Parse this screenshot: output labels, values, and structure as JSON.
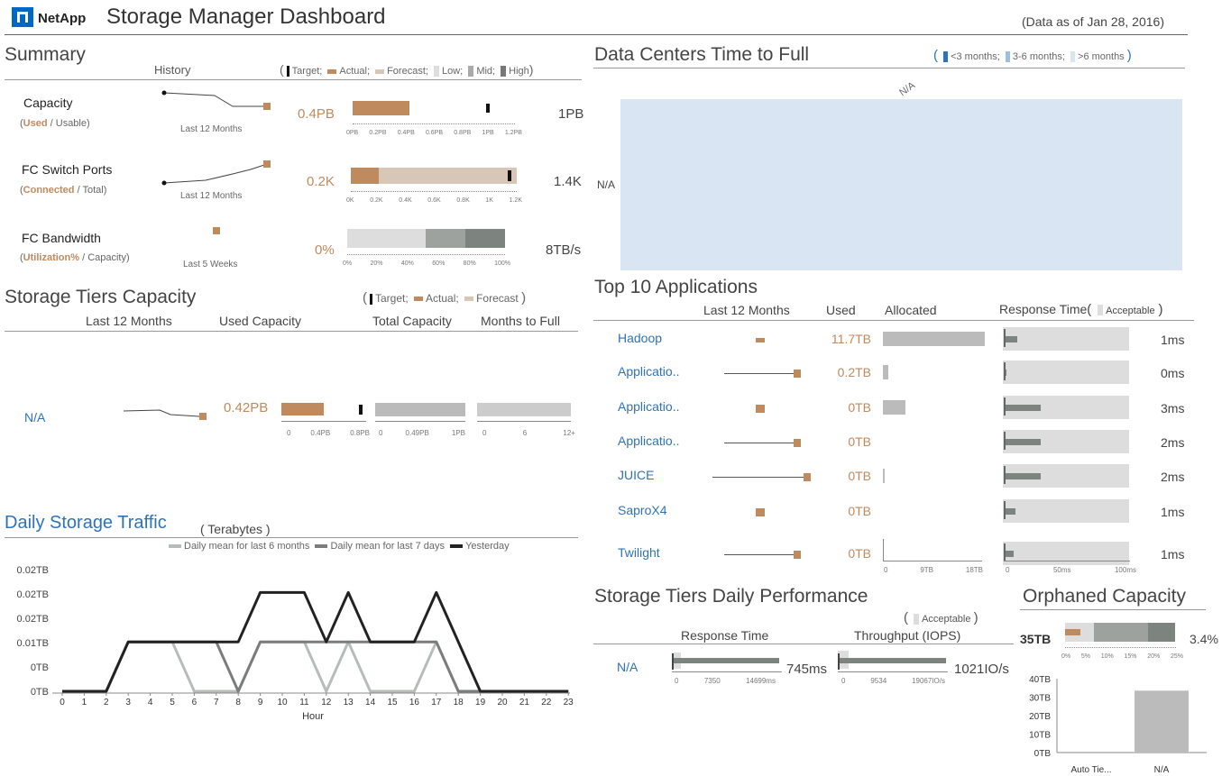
{
  "header": {
    "brand": "NetApp",
    "title": "Storage Manager Dashboard",
    "data_as_of": "(Data as of Jan 28, 2016)"
  },
  "summary": {
    "title": "Summary",
    "history_label": "History",
    "legend": {
      "target": "Target;",
      "actual": "Actual;",
      "forecast": "Forecast;",
      "low": "Low;",
      "mid": "Mid;",
      "high": "High"
    },
    "rows": [
      {
        "name": "Capacity",
        "sub_a": "Used",
        "sub_sep": " / ",
        "sub_b": "Usable",
        "period": "Last 12 Months",
        "actual": "0.4PB",
        "total": "1PB",
        "ticks": [
          "0PB",
          "0.2PB",
          "0.4PB",
          "0.6PB",
          "0.8PB",
          "1PB",
          "1.2PB"
        ],
        "actual_frac": 0.33,
        "target_frac": 0.83
      },
      {
        "name": "FC Switch Ports",
        "sub_a": "Connected",
        "sub_sep": " / ",
        "sub_b": "Total",
        "period": "Last 12 Months",
        "actual": "0.2K",
        "total": "1.4K",
        "ticks": [
          "0K",
          "0.2K",
          "0.4K",
          "0.6K",
          "0.8K",
          "1K",
          "1.2K"
        ],
        "actual_frac": 0.17,
        "forecast_frac": 1.0,
        "target_frac": 0.97
      },
      {
        "name": "FC Bandwidth",
        "sub_a": "Utilization%",
        "sub_sep": " / ",
        "sub_b": "Capacity)",
        "period": "Last 5 Weeks",
        "actual": "0%",
        "total": "8TB/s",
        "ticks": [
          "0%",
          "20%",
          "40%",
          "60%",
          "80%",
          "100%"
        ],
        "low_frac": 0.5,
        "mid_frac": 0.75
      }
    ]
  },
  "tiers": {
    "title": "Storage Tiers Capacity",
    "legend": {
      "target": "Target;",
      "actual": "Actual;",
      "forecast": "Forecast"
    },
    "columns": [
      "Last 12 Months",
      "Used Capacity",
      "Total Capacity",
      "Months to Full"
    ],
    "row": {
      "name": "N/A",
      "used": "0.42PB",
      "used_ticks": [
        "0",
        "0.4PB",
        "0.8PB"
      ],
      "total_ticks": [
        "0",
        "0.49PB",
        "1PB"
      ],
      "months_ticks": [
        "0",
        "6",
        "12+"
      ]
    }
  },
  "traffic": {
    "title": "Daily Storage Traffic",
    "unit": "( Terabytes )",
    "legend": [
      "Daily mean for last 6 months",
      "Daily mean for last 7 days",
      "Yesterday"
    ],
    "colors": [
      "#b8bcb9",
      "#7a7d7b",
      "#222222"
    ]
  },
  "chart_data": {
    "type": "line",
    "xlabel": "Hour",
    "ylabel": "",
    "x": [
      0,
      1,
      2,
      3,
      4,
      5,
      6,
      7,
      8,
      9,
      10,
      11,
      12,
      13,
      14,
      15,
      16,
      17,
      18,
      19,
      20,
      21,
      22,
      23
    ],
    "y_tick_labels": [
      "0TB",
      "0TB",
      "0.01TB",
      "0.02TB",
      "0.02TB",
      "0.02TB"
    ],
    "ylim": [
      0,
      0.025
    ],
    "series": [
      {
        "name": "Daily mean for last 6 months",
        "values": [
          0,
          0,
          0,
          0.01,
          0.01,
          0.01,
          0,
          0,
          0,
          0.01,
          0.01,
          0.01,
          0,
          0.01,
          0,
          0,
          0,
          0.01,
          0,
          0,
          0,
          0,
          0,
          0
        ]
      },
      {
        "name": "Daily mean for last 7 days",
        "values": [
          0,
          0,
          0,
          0.01,
          0.01,
          0.01,
          0.01,
          0.01,
          0,
          0.01,
          0.01,
          0.01,
          0.01,
          0.01,
          0.01,
          0.01,
          0.01,
          0.01,
          0,
          0,
          0,
          0,
          0,
          0
        ]
      },
      {
        "name": "Yesterday",
        "values": [
          0,
          0,
          0,
          0.01,
          0.01,
          0.01,
          0.01,
          0.01,
          0.01,
          0.02,
          0.02,
          0.02,
          0.01,
          0.02,
          0.01,
          0.01,
          0.01,
          0.02,
          0.01,
          0,
          0,
          0,
          0,
          0
        ]
      }
    ]
  },
  "datacenters": {
    "title": "Data Centers Time to Full",
    "legend": [
      "<3 months;",
      "3-6 months;",
      ">6 months"
    ],
    "x_label": "N/A",
    "y_label": "N/A"
  },
  "apps": {
    "title": "Top 10 Applications",
    "columns": {
      "history": "Last 12 Months",
      "used": "Used",
      "allocated": "Allocated",
      "response": "Response Time",
      "acceptable": "Acceptable"
    },
    "rows": [
      {
        "name": "Hadoop",
        "used": "11.7TB",
        "time": "1ms",
        "alloc": 1.0,
        "rt": 0.11
      },
      {
        "name": "Applicatio..",
        "used": "0.2TB",
        "time": "0ms",
        "alloc": 0.05,
        "rt": 0.02
      },
      {
        "name": "Applicatio..",
        "used": "0TB",
        "time": "3ms",
        "alloc": 0.22,
        "rt": 0.29
      },
      {
        "name": "Applicatio..",
        "used": "0TB",
        "time": "2ms",
        "alloc": 0,
        "rt": 0.29
      },
      {
        "name": "JUICE",
        "used": "0TB",
        "time": "2ms",
        "alloc": 0.02,
        "rt": 0.29
      },
      {
        "name": "SaproX4",
        "used": "0TB",
        "time": "1ms",
        "alloc": 0,
        "rt": 0.09
      },
      {
        "name": "Twilight",
        "used": "0TB",
        "time": "1ms",
        "alloc": 0,
        "rt": 0.08
      }
    ],
    "alloc_ticks": [
      "0",
      "9TB",
      "18TB"
    ],
    "rt_ticks": [
      "0",
      "50ms",
      "100ms"
    ]
  },
  "perf": {
    "title": "Storage Tiers Daily Performance",
    "acceptable": "Acceptable",
    "columns": [
      "Response Time",
      "Throughput (IOPS)"
    ],
    "row": {
      "name": "N/A",
      "response": "745ms",
      "throughput": "1021IO/s"
    },
    "rt_ticks": [
      "0",
      "7350",
      "14699ms"
    ],
    "tp_ticks": [
      "0",
      "9534",
      "19067IO/s"
    ]
  },
  "orphaned": {
    "title": "Orphaned Capacity",
    "value": "35TB",
    "pct": "3.4%",
    "ticks": [
      "0%",
      "5%",
      "10%",
      "15%",
      "20%",
      "25%"
    ],
    "bar_y_ticks": [
      "40TB",
      "30TB",
      "20TB",
      "10TB",
      "0TB"
    ],
    "bar_categories": [
      "Auto Tie...",
      "N/A"
    ],
    "bar_values": [
      0,
      33.5
    ]
  }
}
